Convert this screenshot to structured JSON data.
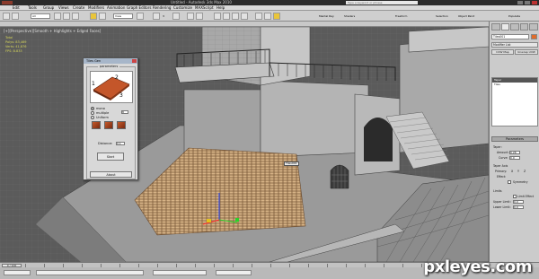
{
  "window": {
    "title": "Untitled - Autodesk 3ds Max 2010",
    "search_placeholder": "Type a keyword or phrase"
  },
  "menu": [
    "Edit",
    "Tools",
    "Group",
    "Views",
    "Create",
    "Modifiers",
    "Animation",
    "Graph Editors",
    "Rendering",
    "Customize",
    "MAXScript",
    "Help"
  ],
  "toolbar": {
    "selection_filter": "All",
    "view_mode": "View",
    "snaps_value": "3",
    "labels": [
      "Mental Ray",
      "Shaders",
      "Freeform",
      "Selection",
      "Object Paint",
      "Populate"
    ]
  },
  "viewport": {
    "label": "[+][Perspective][Smooth + Highlights + Edged Faces]",
    "stats": [
      "Total",
      "Polys: 83,469",
      "Verts: 41,876",
      "",
      "FPS: 8.833"
    ],
    "object_label": "Tiles001"
  },
  "dialog": {
    "title": "Tiles Gen",
    "group_title": "parameters",
    "preview_numbers": [
      "1",
      "2",
      "3"
    ],
    "radio_options": [
      "mono",
      "multiple",
      "Uniform"
    ],
    "options_spinner": "8",
    "distance_label": "Distance:",
    "distance_value": "0.1",
    "start_button": "Start",
    "about_button": "About"
  },
  "command_panel": {
    "object_name": "Tiles001",
    "modifier_list_label": "Modifier List",
    "buttons": [
      "UVW Map",
      "Unwrap UVW"
    ],
    "stack_items": [
      "Taper",
      "Tiles"
    ],
    "parameters_rollout": "Parameters",
    "taper_label": "Taper:",
    "amount_label": "Amount:",
    "amount_value": "0.26",
    "curve_label": "Curve:",
    "curve_value": "0.0",
    "taper_axis_label": "Taper Axis",
    "primary_label": "Primary:",
    "effect_label": "Effect:",
    "symmetry_label": "Symmetry",
    "axes": [
      "X",
      "Y",
      "Z"
    ],
    "limits_label": "Limits",
    "limit_effect_label": "Limit Effect",
    "upper_limit_label": "Upper Limit:",
    "lower_limit_label": "Lower Limit:",
    "upper_limit_value": "0.0",
    "lower_limit_value": "0.0"
  },
  "timeline": {
    "frame_range": "0 / 100"
  },
  "watermark": "pxleyes.com",
  "colors": {
    "viewport_bg": "#5b5b5b",
    "tiles": "#c9a27a",
    "building": "#b5b5b5"
  }
}
